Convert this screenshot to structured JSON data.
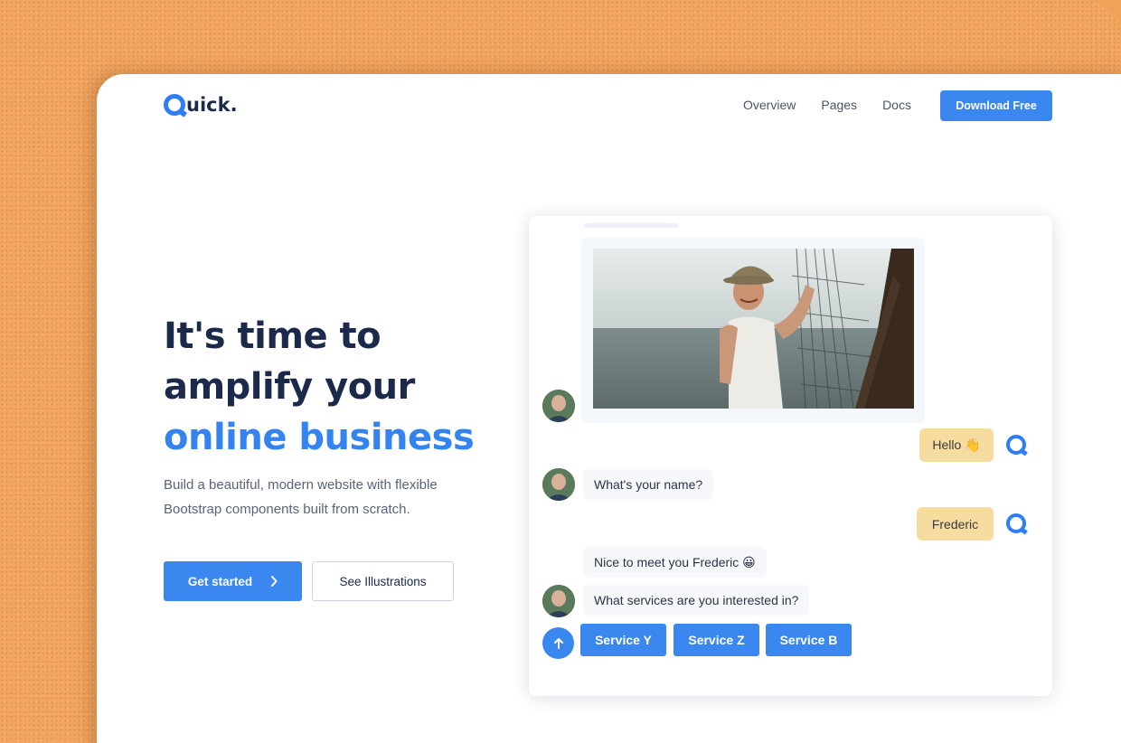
{
  "brand": {
    "name": "uick.",
    "logo_icon": "q-logo-icon"
  },
  "nav": {
    "links": [
      "Overview",
      "Pages",
      "Docs"
    ],
    "cta": "Download Free"
  },
  "hero": {
    "title_line1": "It's time to",
    "title_line2": "amplify your",
    "title_line3": "online business",
    "subtitle_line1": "Build a beautiful, modern website with flexible",
    "subtitle_line2": "Bootstrap components built from scratch.",
    "primary_button": "Get started",
    "primary_button_icon": "chevron-right-icon",
    "secondary_button": "See Illustrations"
  },
  "chat": {
    "messages": {
      "user_hello": "Hello 👋",
      "bot_name_question": "What's your name?",
      "user_name": "Frederic",
      "bot_greeting": "Nice to meet you Frederic 😀",
      "bot_services_question": "What services are you interested in?"
    },
    "service_options": [
      "Service Y",
      "Service Z",
      "Service B"
    ],
    "scroll_up_icon": "arrow-up-icon"
  },
  "colors": {
    "accent": "#3b87f0",
    "heading": "#1b2a4a",
    "user_bubble": "#f6dc9e",
    "background": "#f2a55e"
  }
}
